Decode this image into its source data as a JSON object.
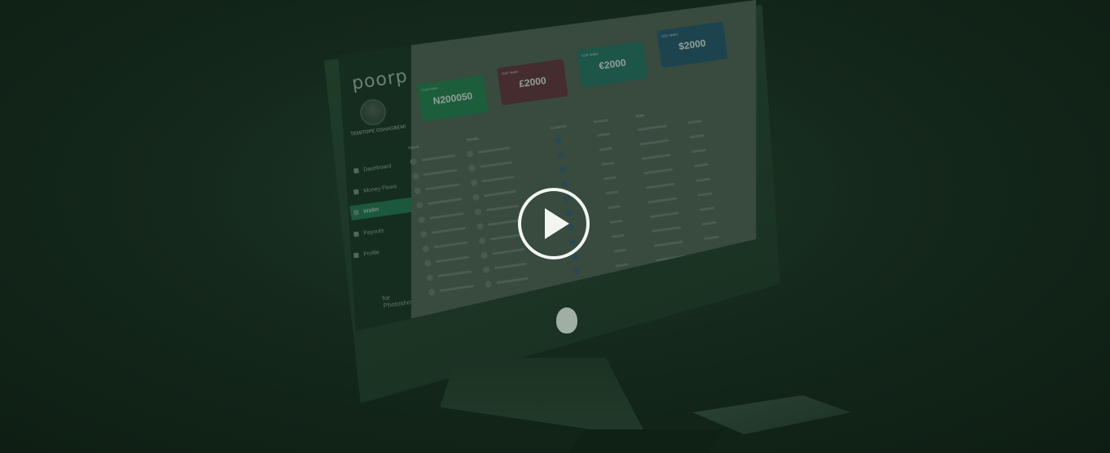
{
  "sidebar": {
    "logo": "poorp",
    "user_name": "TEMITOPE OSHAGBEMI",
    "nav_items": [
      "Dashboard",
      "Money Flows",
      "Wallet",
      "Payouts",
      "Profile"
    ],
    "footer_text": "for Photoshop"
  },
  "cards": [
    {
      "caption": "Cash Flow",
      "value": "N200050"
    },
    {
      "caption": "GBP Wallet",
      "value": "£2000"
    },
    {
      "caption": "EUR Wallet",
      "value": "€2000"
    },
    {
      "caption": "USD Wallet",
      "value": "$2000"
    }
  ],
  "table": {
    "headers": [
      "Name",
      "Details",
      "Currency",
      "Amount",
      "Date"
    ],
    "rows": 10
  },
  "media": {
    "play_icon": "play-circle-icon"
  }
}
